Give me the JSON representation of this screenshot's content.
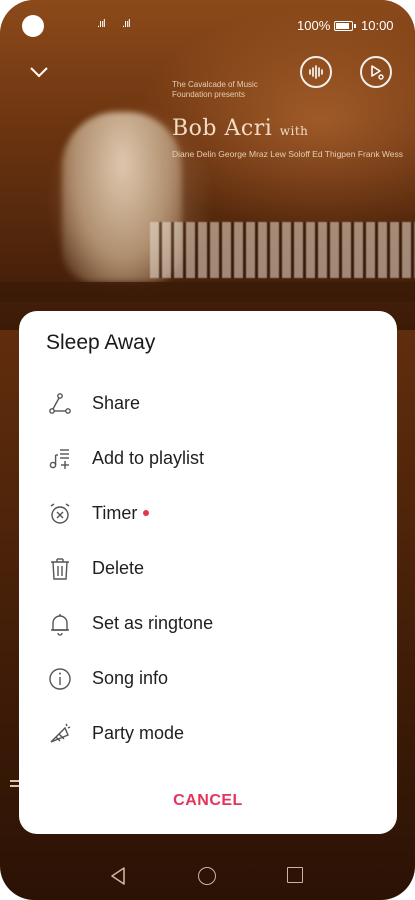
{
  "status_bar": {
    "battery": "100%",
    "time": "10:00",
    "signal": ".ııl"
  },
  "album_art": {
    "presenter": "The Cavalcade of Music Foundation presents",
    "artist": "Bob Acri",
    "artist_suffix": "with",
    "credits": "Diane Delin  George Mraz  Lew Soloff  Ed Thigpen  Frank Wess"
  },
  "sheet": {
    "title": "Sleep Away",
    "items": [
      {
        "label": "Share",
        "icon": "share-icon"
      },
      {
        "label": "Add to playlist",
        "icon": "add-to-playlist-icon"
      },
      {
        "label": "Timer",
        "icon": "alarm-clock-icon",
        "badge": true
      },
      {
        "label": "Delete",
        "icon": "trash-icon"
      },
      {
        "label": "Set as ringtone",
        "icon": "bell-icon"
      },
      {
        "label": "Song info",
        "icon": "info-icon"
      },
      {
        "label": "Party mode",
        "icon": "party-horn-icon"
      }
    ],
    "cancel": "CANCEL"
  },
  "colors": {
    "accent": "#e4345a",
    "badge": "#e8334a"
  }
}
